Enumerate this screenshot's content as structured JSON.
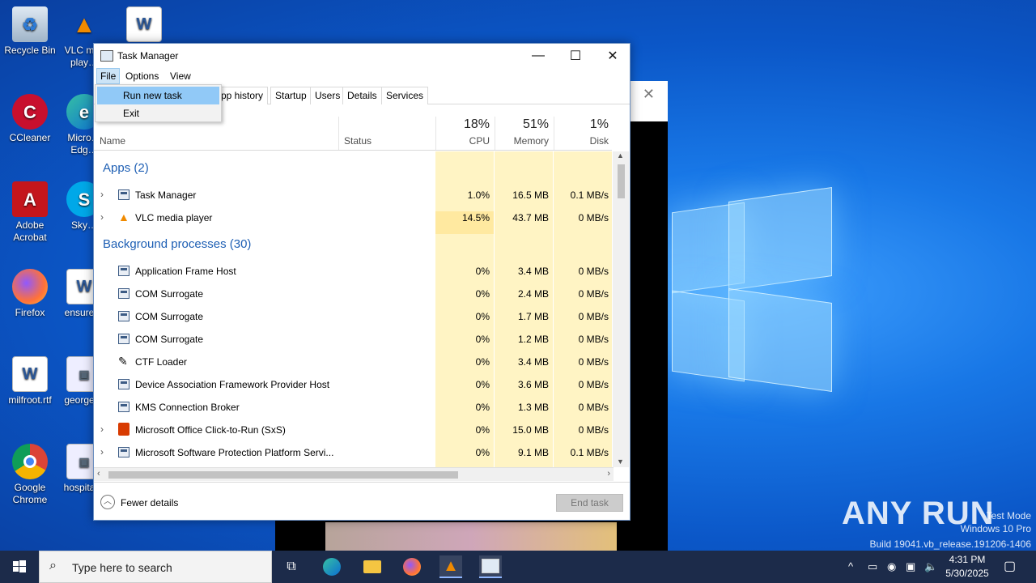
{
  "desktop": {
    "icons": [
      {
        "label": "Recycle Bin"
      },
      {
        "label": "VLC m… play…"
      },
      {
        "label": "CCleaner"
      },
      {
        "label": "Micro… Edg…"
      },
      {
        "label": "Adobe Acrobat"
      },
      {
        "label": "Sky…"
      },
      {
        "label": "Firefox"
      },
      {
        "label": "ensure…"
      },
      {
        "label": "milfroot.rtf"
      },
      {
        "label": "george…"
      },
      {
        "label": "Google Chrome"
      },
      {
        "label": "hospita…"
      }
    ],
    "watermark": {
      "brand": "ANY RUN",
      "line1": "Test Mode",
      "line2": "Windows 10 Pro",
      "line3": "Build 19041.vb_release.191206-1406"
    }
  },
  "window": {
    "title": "Task Manager",
    "minimize": "—",
    "maximize": "☐",
    "close": "✕"
  },
  "menu": {
    "file": "File",
    "options": "Options",
    "view": "View",
    "file_items": [
      "Run new task",
      "Exit"
    ]
  },
  "tabs": [
    "pp history",
    "Startup",
    "Users",
    "Details",
    "Services"
  ],
  "columns": {
    "name": "Name",
    "status": "Status",
    "cpu": {
      "pct": "18%",
      "label": "CPU"
    },
    "memory": {
      "pct": "51%",
      "label": "Memory"
    },
    "disk": {
      "pct": "1%",
      "label": "Disk"
    }
  },
  "groups": {
    "apps": "Apps (2)",
    "background": "Background processes (30)"
  },
  "apps": [
    {
      "name": "Task Manager",
      "cpu": "1.0%",
      "memory": "16.5 MB",
      "disk": "0.1 MB/s"
    },
    {
      "name": "VLC media player",
      "cpu": "14.5%",
      "memory": "43.7 MB",
      "disk": "0 MB/s"
    }
  ],
  "background": [
    {
      "name": "Application Frame Host",
      "cpu": "0%",
      "memory": "3.4 MB",
      "disk": "0 MB/s"
    },
    {
      "name": "COM Surrogate",
      "cpu": "0%",
      "memory": "2.4 MB",
      "disk": "0 MB/s"
    },
    {
      "name": "COM Surrogate",
      "cpu": "0%",
      "memory": "1.7 MB",
      "disk": "0 MB/s"
    },
    {
      "name": "COM Surrogate",
      "cpu": "0%",
      "memory": "1.2 MB",
      "disk": "0 MB/s"
    },
    {
      "name": "CTF Loader",
      "cpu": "0%",
      "memory": "3.4 MB",
      "disk": "0 MB/s"
    },
    {
      "name": "Device Association Framework Provider Host",
      "cpu": "0%",
      "memory": "3.6 MB",
      "disk": "0 MB/s"
    },
    {
      "name": "KMS Connection Broker",
      "cpu": "0%",
      "memory": "1.3 MB",
      "disk": "0 MB/s"
    },
    {
      "name": "Microsoft Office Click-to-Run (SxS)",
      "cpu": "0%",
      "memory": "15.0 MB",
      "disk": "0 MB/s"
    },
    {
      "name": "Microsoft Software Protection Platform Servi...",
      "cpu": "0%",
      "memory": "9.1 MB",
      "disk": "0.1 MB/s"
    }
  ],
  "footer": {
    "fewer_details": "Fewer details",
    "end_task": "End task"
  },
  "taskbar": {
    "search_placeholder": "Type here to search",
    "time": "4:31 PM",
    "date": "5/30/2025"
  }
}
